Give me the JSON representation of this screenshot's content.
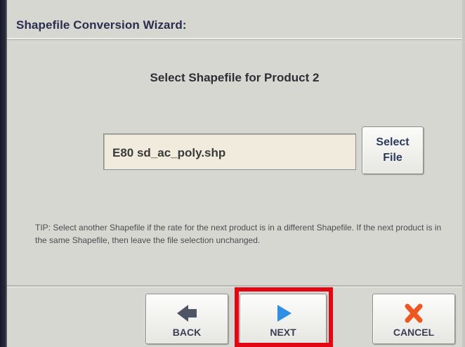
{
  "window": {
    "title": "Shapefile Conversion Wizard:"
  },
  "instruction": "Select Shapefile for Product 2",
  "file_field": {
    "value": "E80 sd_ac_poly.shp"
  },
  "select_file_button": {
    "line1": "Select",
    "line2": "File"
  },
  "tip": "TIP:  Select another Shapefile if the rate for the next product is in a different Shapefile.  If the next product is in the same Shapefile, then leave the file selection unchanged.",
  "nav": {
    "back_label": "BACK",
    "next_label": "NEXT",
    "cancel_label": "CANCEL",
    "back_icon": "back-arrow-icon",
    "next_icon": "next-arrow-icon",
    "cancel_icon": "cancel-x-icon"
  },
  "colors": {
    "highlight": "#e30613",
    "next_arrow": "#2f8fe6",
    "back_arrow": "#4e5565",
    "cancel_x": "#f0561f"
  }
}
